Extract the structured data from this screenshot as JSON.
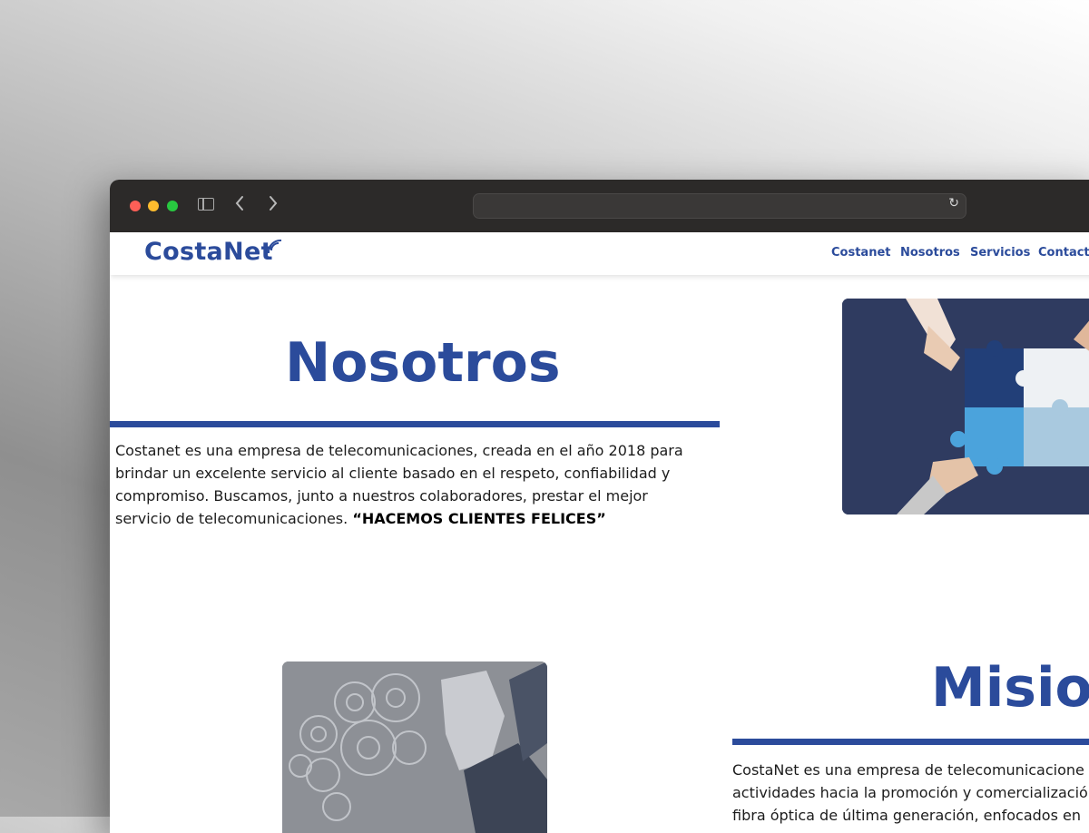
{
  "browser": {
    "address_text": ""
  },
  "site": {
    "logo_text": "CostaNet",
    "nav": [
      "Costanet",
      "Nosotros",
      "Servicios",
      "Contacto"
    ]
  },
  "about": {
    "title": "Nosotros",
    "body": "Costanet es una empresa de telecomunicaciones, creada en el año 2018 para brindar un excelente servicio al cliente basado en el respeto, confiabilidad y compromiso. Buscamos, junto a nuestros colaboradores, prestar el mejor servicio de telecomunicaciones. ",
    "slogan": "“HACEMOS CLIENTES FELICES”"
  },
  "mission": {
    "title": "Mision",
    "body_lines": [
      "CostaNet es una empresa de telecomunicacione",
      "actividades hacia la promoción y comercializació",
      "fibra óptica de última generación, enfocados en"
    ]
  },
  "colors": {
    "brand": "#2b4b9b",
    "puzzle_bg": "#2e3a5e"
  },
  "icons": [
    "sidebar-icon",
    "back-icon",
    "forward-icon",
    "reload-icon",
    "signal-icon",
    "puzzle-image",
    "gears-image"
  ]
}
